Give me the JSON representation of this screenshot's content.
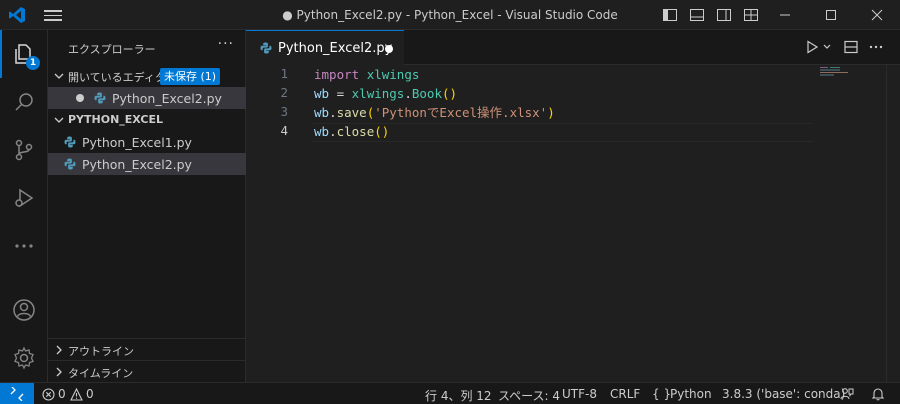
{
  "window": {
    "title": "● Python_Excel2.py - Python_Excel - Visual Studio Code"
  },
  "activity": {
    "explorer_badge": "1",
    "items": [
      "files-icon",
      "search-icon",
      "source-control-icon",
      "run-debug-icon",
      "more-icon",
      "account-icon",
      "settings-icon"
    ]
  },
  "sidebar": {
    "header": "エクスプローラー",
    "more": "···",
    "open_editors": {
      "title": "開いているエディター",
      "unsaved_badge": "未保存 (1)",
      "files": [
        "Python_Excel2.py"
      ]
    },
    "folder": {
      "title": "PYTHON_EXCEL",
      "files": [
        "Python_Excel1.py",
        "Python_Excel2.py"
      ]
    },
    "outline": "アウトライン",
    "timeline": "タイムライン"
  },
  "editor": {
    "tab_label": "Python_Excel2.py",
    "line_numbers": [
      "1",
      "2",
      "3",
      "4"
    ],
    "current_line": 4
  },
  "statusbar": {
    "problems_errors": "0",
    "problems_warnings": "0",
    "cursor": "行 4、列 12",
    "spaces": "スペース: 4",
    "encoding": "UTF-8",
    "eol": "CRLF",
    "language": "Python",
    "interpreter": "3.8.3 ('base': conda)"
  },
  "colors": {
    "accent": "#0078d4",
    "background": "#1f1f1f",
    "sidebar": "#181818"
  }
}
